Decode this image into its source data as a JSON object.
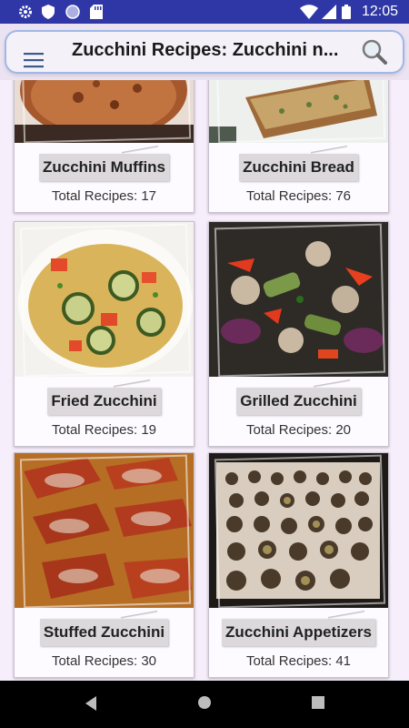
{
  "status_bar": {
    "time": "12:05",
    "icons": [
      "gear-icon",
      "shield-icon",
      "circle-icon",
      "sd-card-icon",
      "wifi-icon",
      "signal-icon",
      "battery-icon"
    ]
  },
  "app_bar": {
    "title": "Zucchini Recipes: Zucchini n..."
  },
  "cards": [
    {
      "name": "Zucchini Muffins",
      "count": "Total Recipes: 17"
    },
    {
      "name": "Zucchini Bread",
      "count": "Total Recipes: 76"
    },
    {
      "name": "Fried Zucchini",
      "count": "Total Recipes: 19"
    },
    {
      "name": "Grilled Zucchini",
      "count": "Total Recipes: 20"
    },
    {
      "name": "Stuffed Zucchini",
      "count": "Total Recipes: 30"
    },
    {
      "name": "Zucchini Appetizers",
      "count": "Total Recipes: 41"
    }
  ],
  "colors": {
    "status_bar": "#2f37a6",
    "background": "#f6eefa",
    "label_bg": "#dcd8dc"
  }
}
